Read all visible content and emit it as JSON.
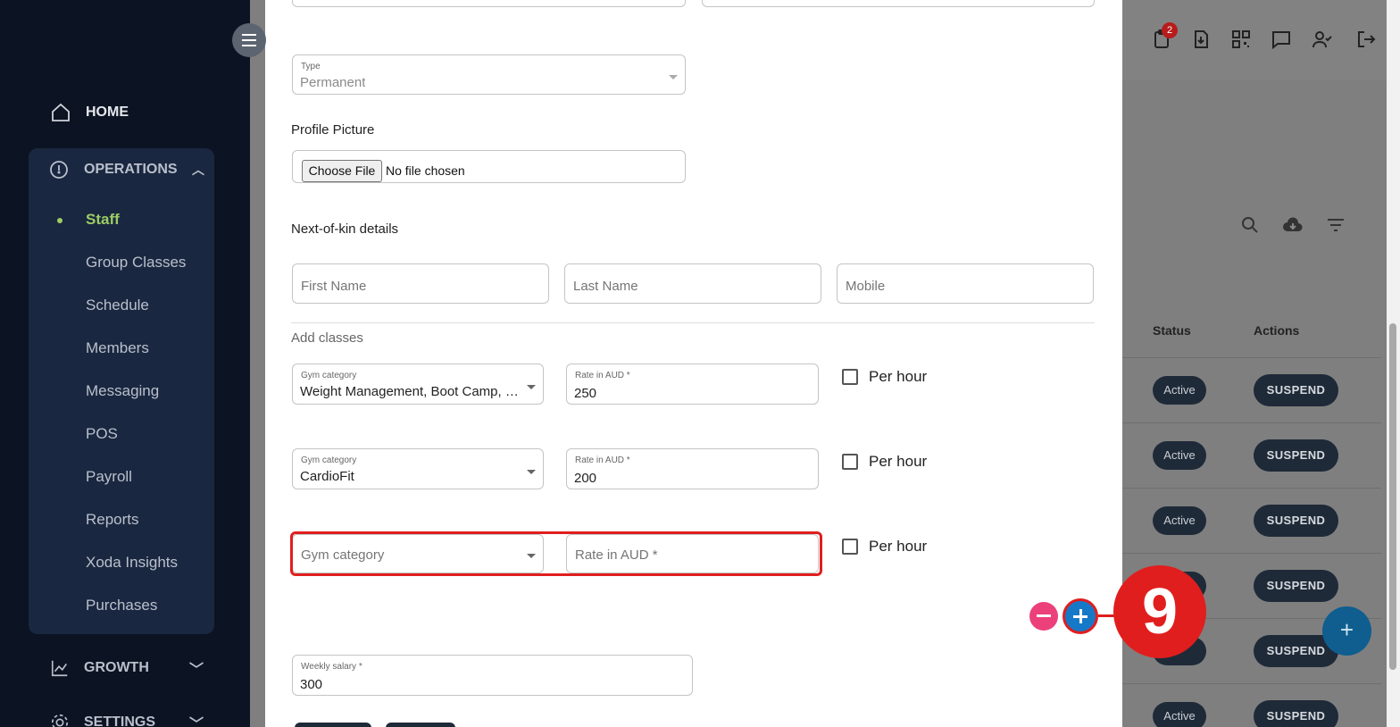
{
  "sidebar": {
    "home": "HOME",
    "operations": {
      "label": "OPERATIONS",
      "items": [
        "Staff",
        "Group Classes",
        "Schedule",
        "Members",
        "Messaging",
        "POS",
        "Payroll",
        "Reports",
        "Xoda Insights",
        "Purchases"
      ]
    },
    "growth": "GROWTH",
    "settings": "SETTINGS"
  },
  "header": {
    "notification_count": "2"
  },
  "table": {
    "headers": {
      "status": "Status",
      "actions": "Actions"
    },
    "rows": [
      {
        "status": "Active",
        "action": "SUSPEND"
      },
      {
        "status": "Active",
        "action": "SUSPEND"
      },
      {
        "status": "Active",
        "action": "SUSPEND"
      },
      {
        "status": "",
        "action": "SUSPEND"
      },
      {
        "status": "",
        "action": "SUSPEND"
      },
      {
        "status": "Active",
        "action": "SUSPEND"
      }
    ]
  },
  "form": {
    "type": {
      "label": "Type",
      "value": "Permanent"
    },
    "profile_picture": {
      "label": "Profile Picture",
      "button": "Choose File",
      "status": "No file chosen"
    },
    "next_of_kin": {
      "heading": "Next-of-kin details",
      "first_name_placeholder": "First Name",
      "last_name_placeholder": "Last Name",
      "mobile_placeholder": "Mobile"
    },
    "add_classes": {
      "heading": "Add classes",
      "rows": [
        {
          "category_label": "Gym category",
          "category_value": "Weight Management, Boot Camp, R...",
          "rate_label": "Rate in AUD *",
          "rate_value": "250",
          "per_hour": "Per hour"
        },
        {
          "category_label": "Gym category",
          "category_value": "CardioFit",
          "rate_label": "Rate in AUD *",
          "rate_value": "200",
          "per_hour": "Per hour"
        },
        {
          "category_placeholder": "Gym category",
          "rate_placeholder": "Rate in AUD *",
          "per_hour": "Per hour"
        }
      ]
    },
    "weekly_salary": {
      "label": "Weekly salary *",
      "value": "300"
    }
  },
  "annotation": {
    "step": "9"
  },
  "fab": "+"
}
